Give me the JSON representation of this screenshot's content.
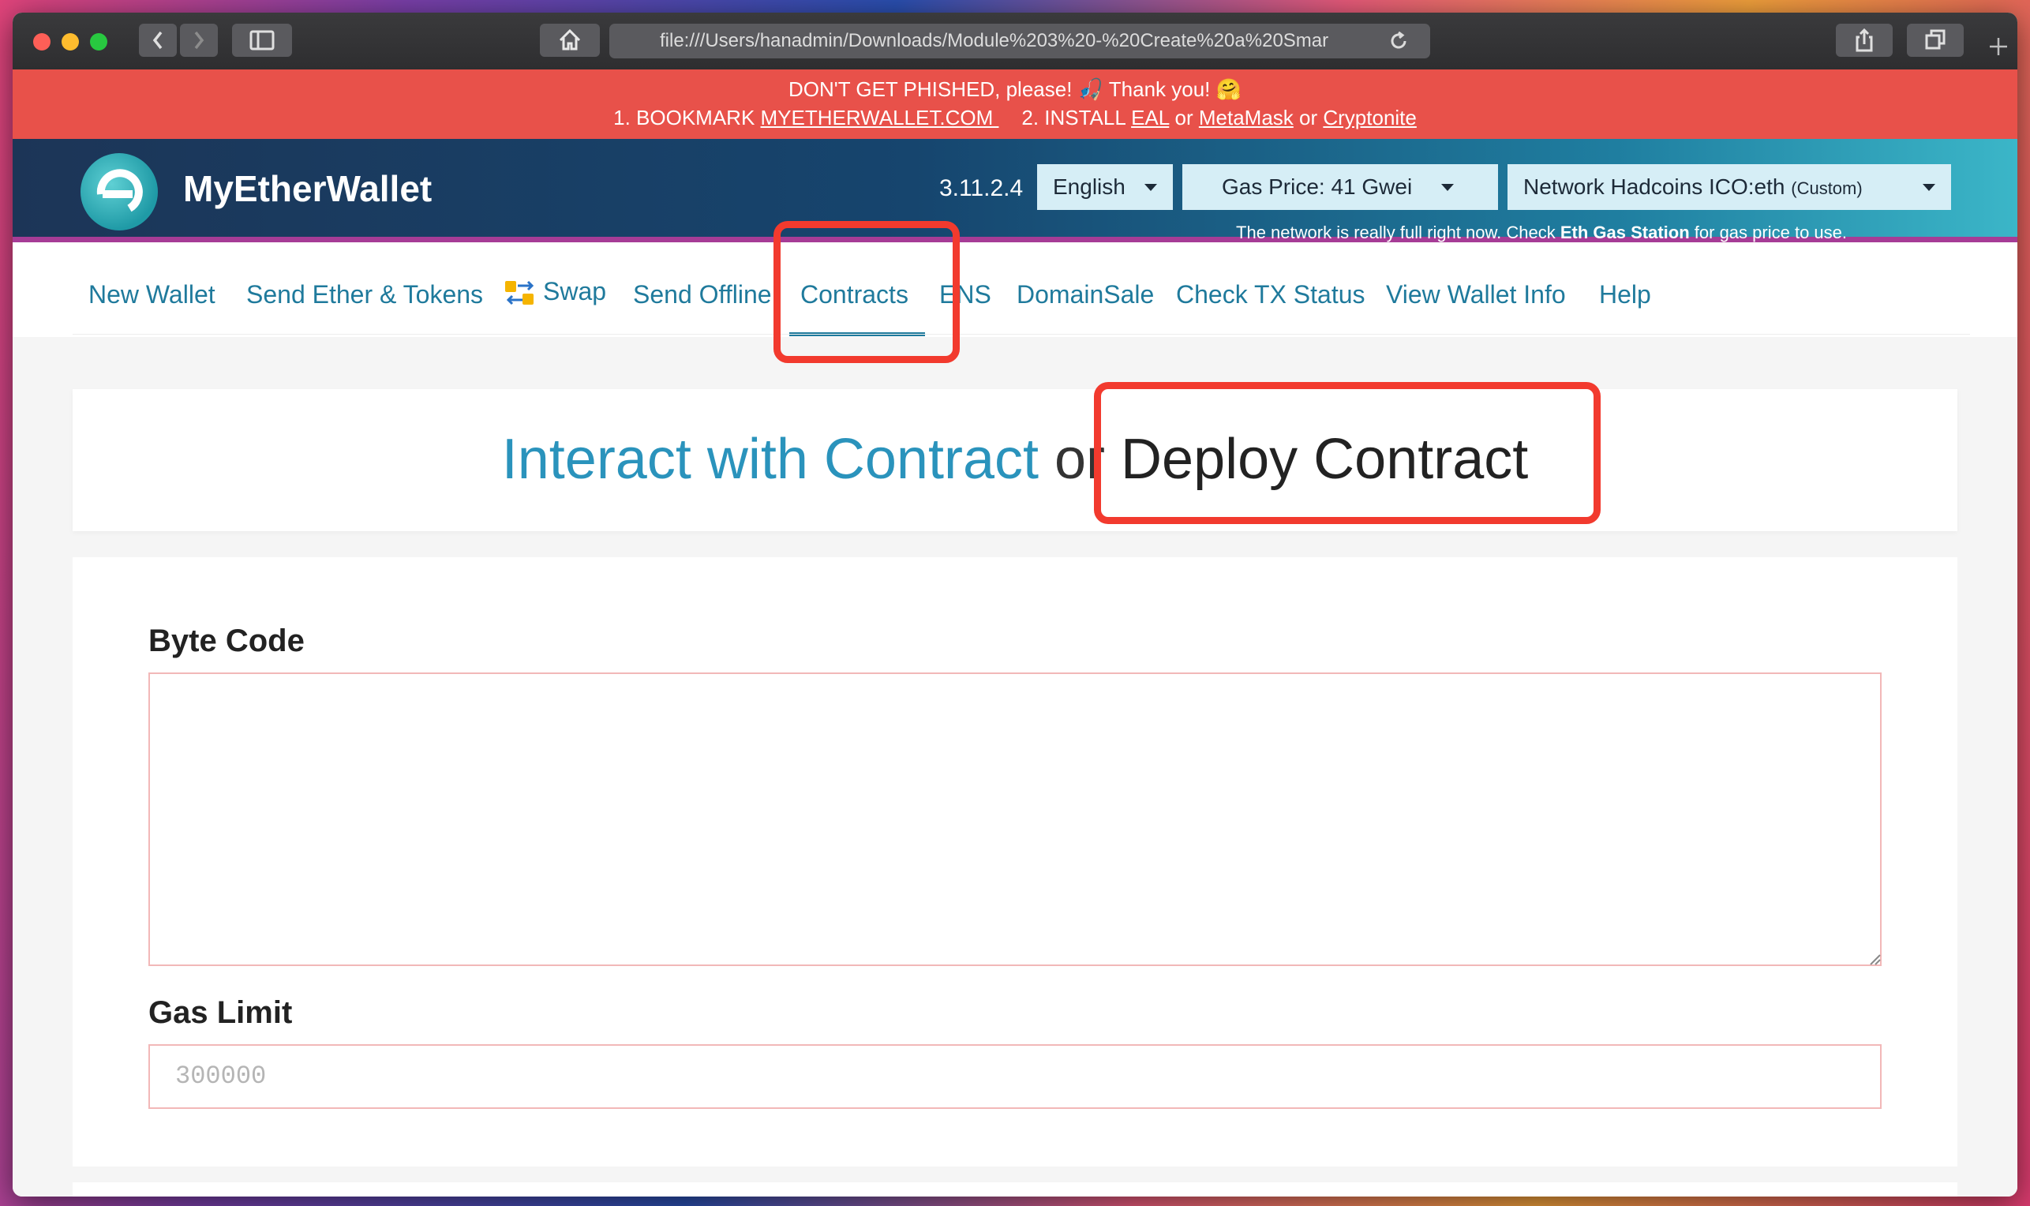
{
  "browser": {
    "url": "file:///Users/hanadmin/Downloads/Module%203%20-%20Create%20a%20Smar"
  },
  "banner": {
    "line1": "DON'T GET PHISHED, please! 🎣 Thank you! 🤗",
    "bookmark_prefix": "1. BOOKMARK ",
    "bookmark_link": "MYETHERWALLET.COM ",
    "install_prefix": "2. INSTALL ",
    "eal": "EAL",
    "or1": " or ",
    "metamask": "MetaMask",
    "or2": " or ",
    "cryptonite": "Cryptonite",
    "bg_color": "#e8514a"
  },
  "header": {
    "brand": "MyEtherWallet",
    "version": "3.11.2.4",
    "language": "English",
    "gas_price": "Gas Price: 41 Gwei",
    "network": "Network Hadcoins ICO:eth",
    "network_suffix": "(Custom)",
    "note_prefix": "The network is really full right now. Check ",
    "note_link": "Eth Gas Station",
    "note_suffix": " for gas price to use."
  },
  "nav": {
    "items": [
      "New Wallet",
      "Send Ether & Tokens",
      "Swap",
      "Send Offline",
      "Contracts",
      "ENS",
      "DomainSale",
      "Check TX Status",
      "View Wallet Info",
      "Help"
    ],
    "active": "Contracts",
    "accent_color": "#1f7a9c"
  },
  "page": {
    "title_interact": "Interact with Contract",
    "title_or": " or ",
    "title_deploy": "Deploy Contract"
  },
  "form": {
    "bytecode_label": "Byte Code",
    "bytecode_value": "",
    "gas_label": "Gas Limit",
    "gas_placeholder": "300000"
  },
  "annotations": {
    "color": "#f23a2e"
  }
}
